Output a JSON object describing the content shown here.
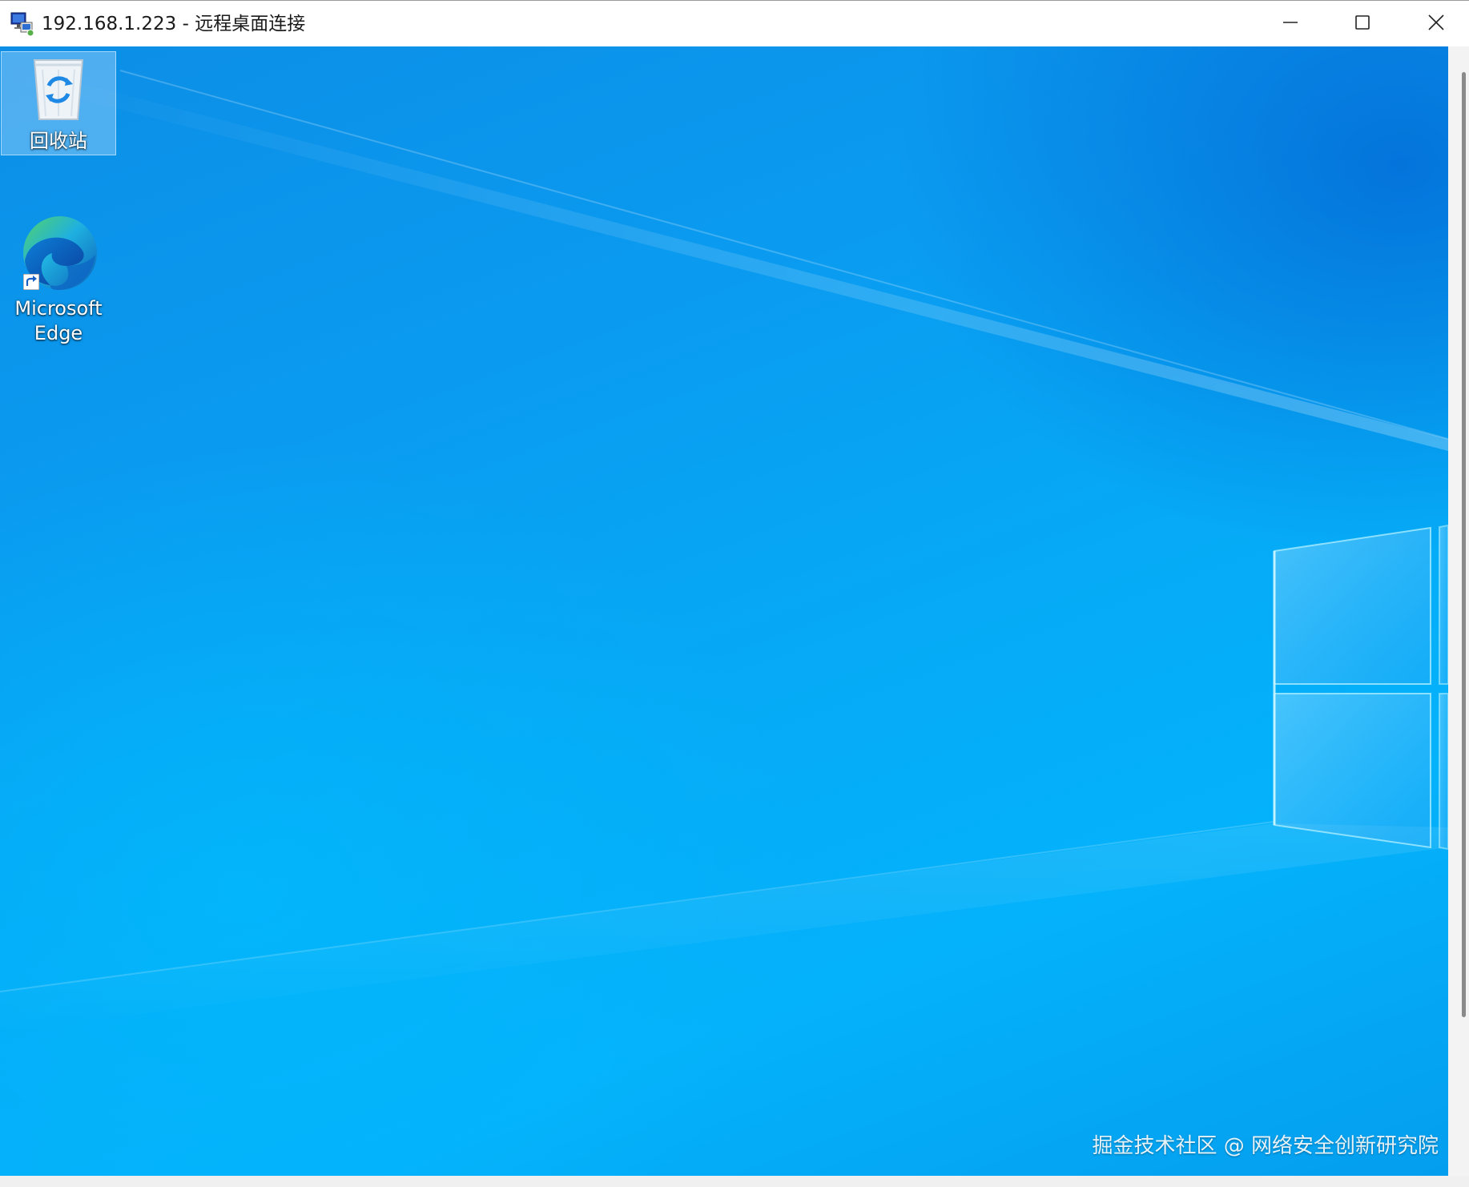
{
  "window": {
    "title": "192.168.1.223 - 远程桌面连接",
    "icon": "remote-desktop-icon",
    "controls": {
      "minimize": "minimize-icon",
      "maximize": "maximize-icon",
      "close": "close-icon"
    }
  },
  "desktop": {
    "icons": [
      {
        "label": "回收站",
        "icon": "recycle-bin-icon",
        "selected": true
      },
      {
        "label": "Microsoft Edge",
        "icon": "edge-icon",
        "shortcut": true
      }
    ],
    "wallpaper": "windows-10-hero",
    "colors": {
      "primary": "#0a9bf0",
      "light": "#04b2fb",
      "dark": "#0c6fd6"
    }
  },
  "watermark": "掘金技术社区 @ 网络安全创新研究院"
}
